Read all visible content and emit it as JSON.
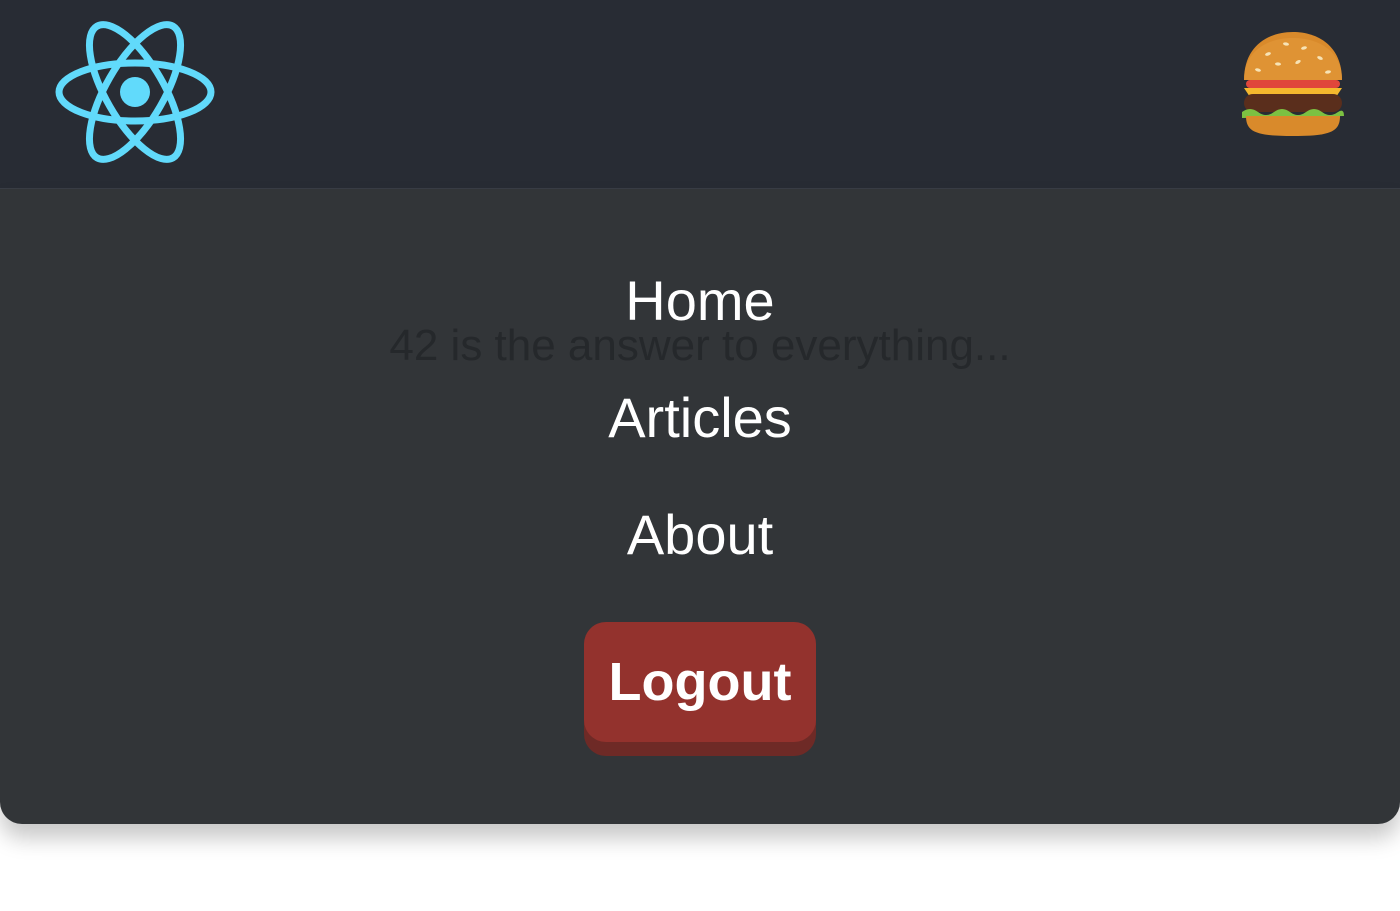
{
  "header": {
    "logo_icon": "react-atom-icon",
    "logo_color": "#61dafb",
    "menu_icon": "hamburger-emoji-icon",
    "background": "#282c34"
  },
  "main": {
    "background_text": "42 is the answer to everything..."
  },
  "menu": {
    "items": [
      {
        "label": "Home"
      },
      {
        "label": "Articles"
      },
      {
        "label": "About"
      }
    ],
    "logout_label": "Logout",
    "logout_color": "#93322d"
  }
}
